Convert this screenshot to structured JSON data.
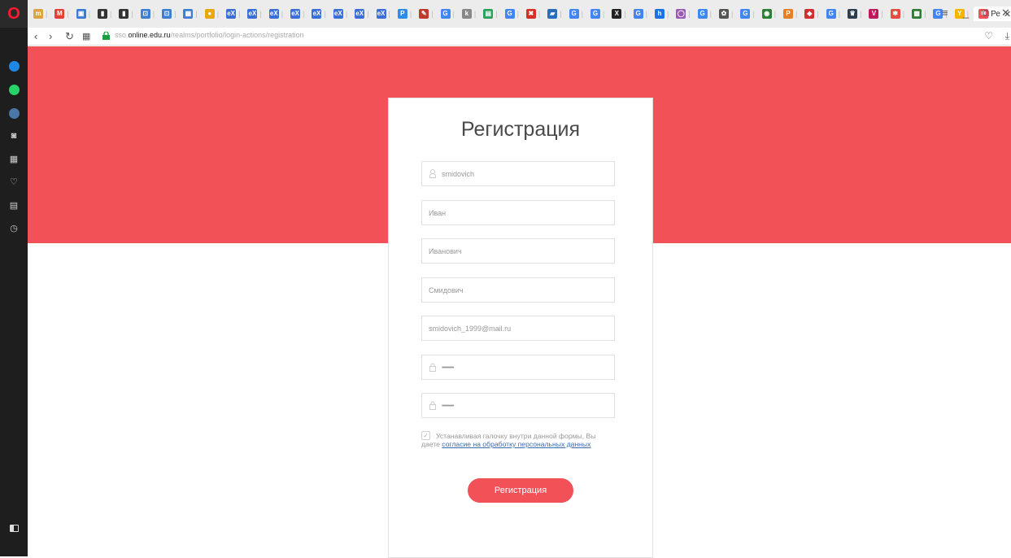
{
  "browser": {
    "logo": "O",
    "tabs": [
      {
        "fav": "m",
        "color": "#d9a441"
      },
      {
        "fav": "M",
        "color": "#e34133"
      },
      {
        "fav": "▣",
        "color": "#3a7bd5"
      },
      {
        "fav": "▮",
        "color": "#333333"
      },
      {
        "fav": "▮",
        "color": "#333333"
      },
      {
        "fav": "⊡",
        "color": "#3f7fd1"
      },
      {
        "fav": "⊡",
        "color": "#3f7fd1"
      },
      {
        "fav": "▦",
        "color": "#3f7fd1"
      },
      {
        "fav": "●",
        "color": "#e9a90a"
      },
      {
        "fav": "eX",
        "color": "#3a6fd8"
      },
      {
        "fav": "eX",
        "color": "#3a6fd8"
      },
      {
        "fav": "eX",
        "color": "#3a6fd8"
      },
      {
        "fav": "eX",
        "color": "#3a6fd8"
      },
      {
        "fav": "eX",
        "color": "#3a6fd8"
      },
      {
        "fav": "eX",
        "color": "#3a6fd8"
      },
      {
        "fav": "eX",
        "color": "#3a6fd8"
      },
      {
        "fav": "eX",
        "color": "#3a6fd8"
      },
      {
        "fav": "P",
        "color": "#2e8be8"
      },
      {
        "fav": "✎",
        "color": "#c0392b"
      },
      {
        "fav": "G",
        "color": "#4285f4"
      },
      {
        "fav": "k",
        "color": "#888888"
      },
      {
        "fav": "▤",
        "color": "#2e9e5b"
      },
      {
        "fav": "G",
        "color": "#4285f4"
      },
      {
        "fav": "✖",
        "color": "#d93025"
      },
      {
        "fav": "▰",
        "color": "#2a6ebb"
      },
      {
        "fav": "G",
        "color": "#4285f4"
      },
      {
        "fav": "G",
        "color": "#4285f4"
      },
      {
        "fav": "X",
        "color": "#222222"
      },
      {
        "fav": "G",
        "color": "#4285f4"
      },
      {
        "fav": "h",
        "color": "#1a73e8"
      },
      {
        "fav": "◯",
        "color": "#9b59b6"
      },
      {
        "fav": "G",
        "color": "#4285f4"
      },
      {
        "fav": "✿",
        "color": "#555555"
      },
      {
        "fav": "G",
        "color": "#4285f4"
      },
      {
        "fav": "◉",
        "color": "#2e7d32"
      },
      {
        "fav": "P",
        "color": "#e67e22"
      },
      {
        "fav": "◆",
        "color": "#d32f2f"
      },
      {
        "fav": "G",
        "color": "#4285f4"
      },
      {
        "fav": "♛",
        "color": "#2c3e50"
      },
      {
        "fav": "V",
        "color": "#c2185b"
      },
      {
        "fav": "✱",
        "color": "#e74c3c"
      },
      {
        "fav": "▩",
        "color": "#2e7d32"
      },
      {
        "fav": "G",
        "color": "#4285f4"
      },
      {
        "fav": "Y",
        "color": "#f4b400"
      }
    ],
    "active_tab": {
      "label": "Ре",
      "fav": "✱",
      "color": "#f35158"
    },
    "after_tab": "G",
    "new_tab": "+",
    "url_prefix": "sso.",
    "url_domain": "online.edu.ru",
    "url_path": "/realms/portfolio/login-actions/registration"
  },
  "sidebar": {
    "items": [
      {
        "icon": "messenger-icon",
        "color": "#1e88e5"
      },
      {
        "icon": "whatsapp-icon",
        "color": "#25d366"
      },
      {
        "icon": "vk-icon",
        "color": "#4a76a8"
      },
      {
        "icon": "camera-icon",
        "glyph": "◙"
      },
      {
        "icon": "speed-dial-icon",
        "glyph": "▦"
      },
      {
        "icon": "heart-icon",
        "glyph": "♡"
      },
      {
        "icon": "news-icon",
        "glyph": "▤"
      },
      {
        "icon": "history-icon",
        "glyph": "◷"
      }
    ]
  },
  "form": {
    "title": "Регистрация",
    "username": "smidovich",
    "first_name": "Иван",
    "middle_name": "Иванович",
    "last_name": "Смидович",
    "email": "smidovich_1999@mail.ru",
    "password_mask": "••••••••••",
    "password_confirm_mask": "••••••••••",
    "consent_text_1": "Устанавливая галочку внутри данной формы, Вы",
    "consent_text_2": "даете ",
    "consent_link": "согласие на обработку персональных данных",
    "submit_label": "Регистрация"
  },
  "colors": {
    "accent": "#f35158",
    "link": "#3c6db0"
  }
}
